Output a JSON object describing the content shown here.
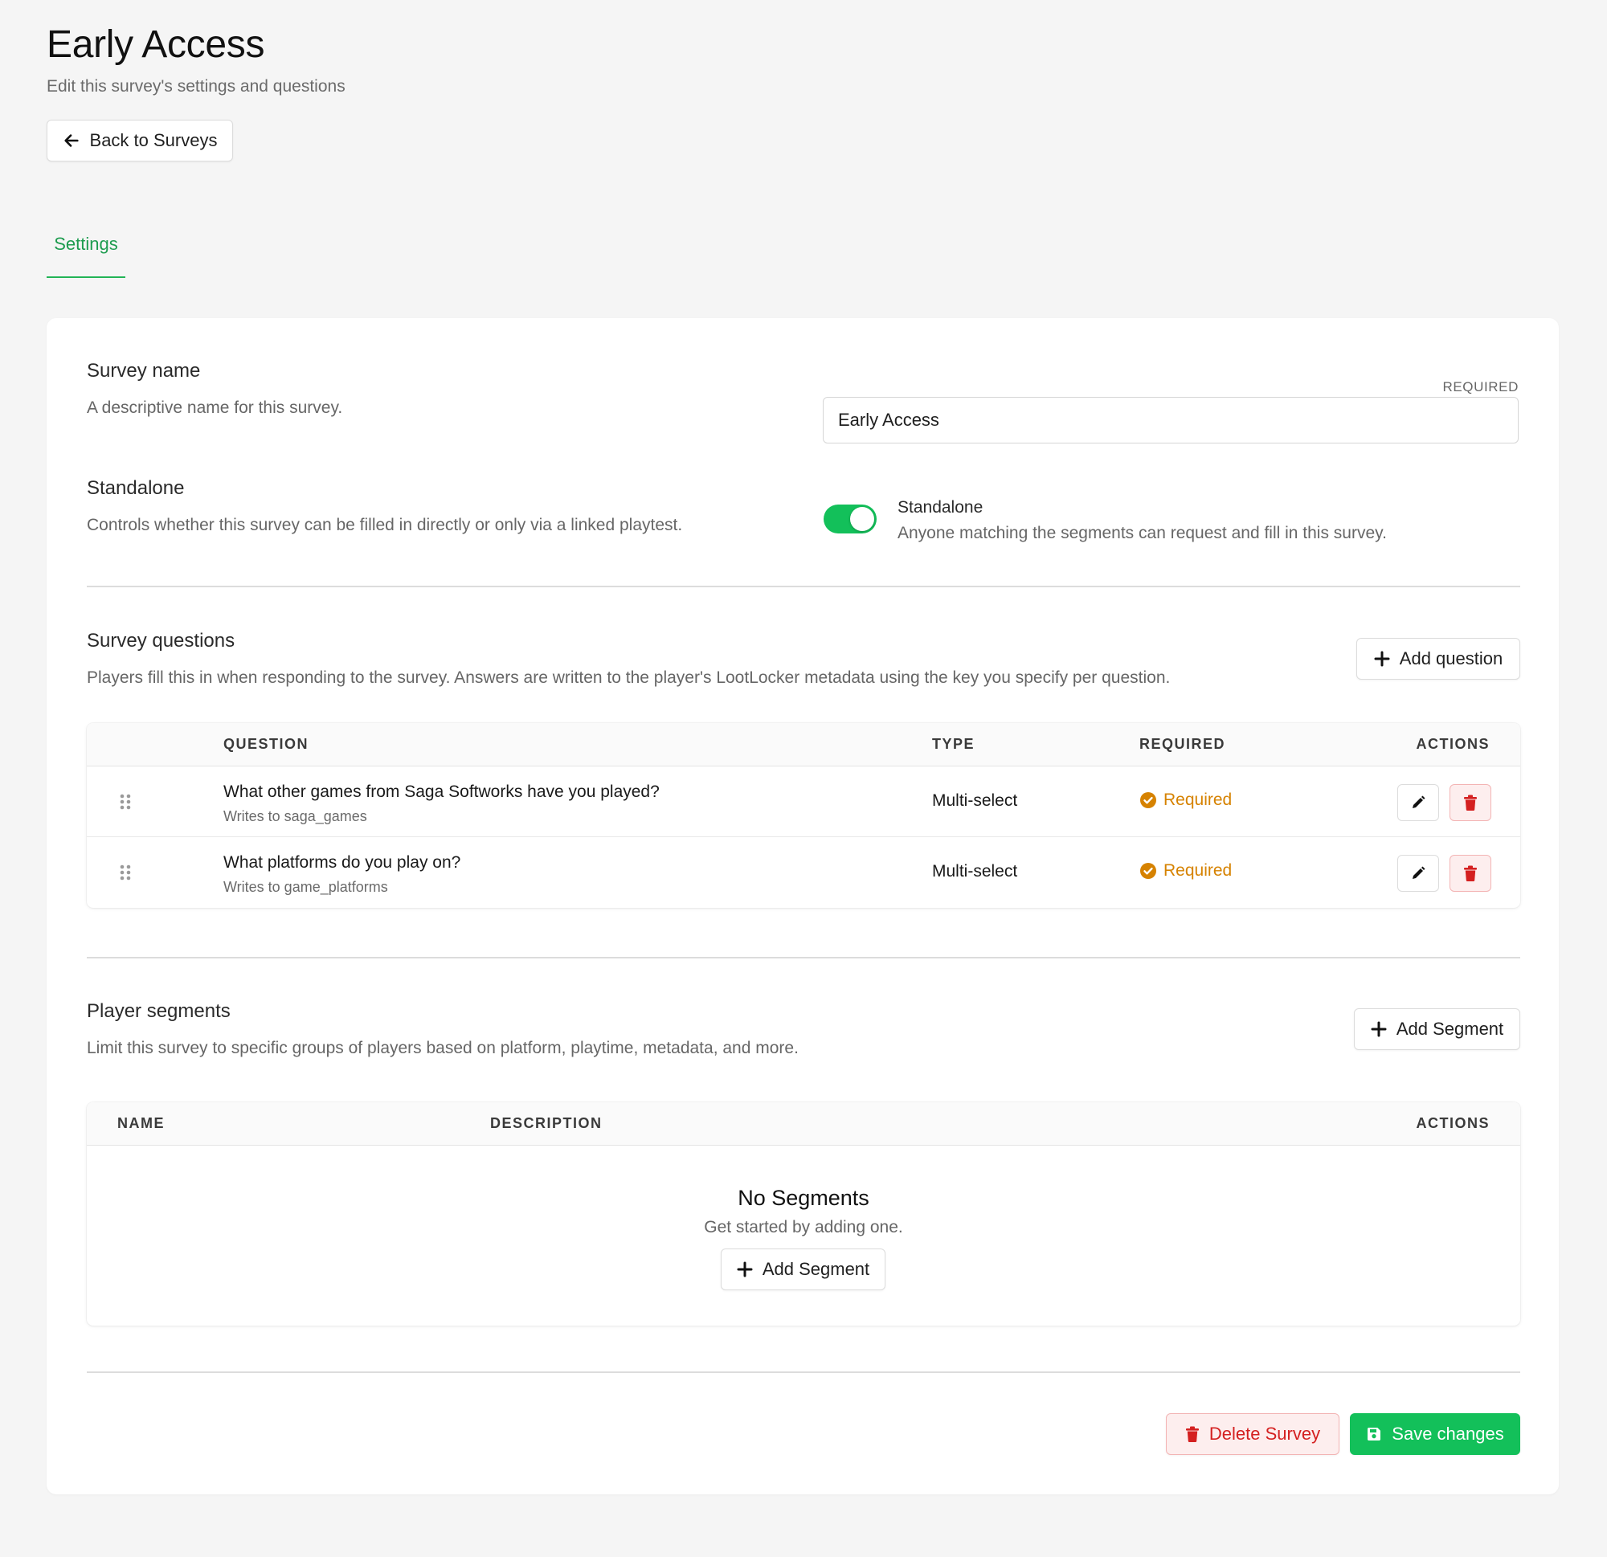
{
  "page": {
    "title": "Early Access",
    "subtitle": "Edit this survey's settings and questions",
    "back_label": "Back to Surveys"
  },
  "tabs": [
    {
      "label": "Settings",
      "active": true
    }
  ],
  "survey_name": {
    "title": "Survey name",
    "description": "A descriptive name for this survey.",
    "required_label": "REQUIRED",
    "value": "Early Access"
  },
  "standalone": {
    "title": "Standalone",
    "description": "Controls whether this survey can be filled in directly or only via a linked playtest.",
    "toggle_on": true,
    "toggle_label": "Standalone",
    "toggle_help": "Anyone matching the segments can request and fill in this survey."
  },
  "questions": {
    "title": "Survey questions",
    "description": "Players fill this in when responding to the survey. Answers are written to the player's LootLocker metadata using the key you specify per question.",
    "add_label": "Add question",
    "columns": [
      "QUESTION",
      "TYPE",
      "REQUIRED",
      "ACTIONS"
    ],
    "rows": [
      {
        "text": "What other games from Saga Softworks have you played?",
        "key": "Writes to saga_games",
        "type": "Multi-select",
        "required": "Required"
      },
      {
        "text": "What platforms do you play on?",
        "key": "Writes to game_platforms",
        "type": "Multi-select",
        "required": "Required"
      }
    ]
  },
  "segments": {
    "title": "Player segments",
    "description": "Limit this survey to specific groups of players based on platform, playtime, metadata, and more.",
    "add_label": "Add Segment",
    "columns": [
      "NAME",
      "DESCRIPTION",
      "ACTIONS"
    ],
    "empty_title": "No Segments",
    "empty_subtitle": "Get started by adding one.",
    "empty_add_label": "Add Segment"
  },
  "footer": {
    "delete_label": "Delete Survey",
    "save_label": "Save changes"
  },
  "colors": {
    "accent_green": "#13c05a",
    "tab_green": "#1e9c4f",
    "required_orange": "#d68200",
    "danger_red": "#d42020"
  }
}
